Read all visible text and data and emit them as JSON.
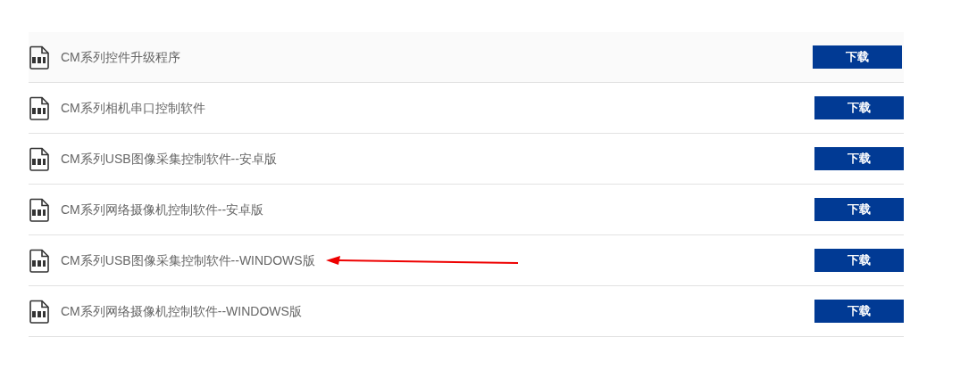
{
  "downloads": [
    {
      "title": "CM系列控件升级程序",
      "button": "下载",
      "highlighted": true,
      "arrow": false
    },
    {
      "title": "CM系列相机串口控制软件",
      "button": "下载",
      "highlighted": false,
      "arrow": false
    },
    {
      "title": "CM系列USB图像采集控制软件--安卓版",
      "button": "下载",
      "highlighted": false,
      "arrow": false
    },
    {
      "title": "CM系列网络摄像机控制软件--安卓版",
      "button": "下载",
      "highlighted": false,
      "arrow": false
    },
    {
      "title": "CM系列USB图像采集控制软件--WINDOWS版",
      "button": "下载",
      "highlighted": false,
      "arrow": true
    },
    {
      "title": "CM系列网络摄像机控制软件--WINDOWS版",
      "button": "下载",
      "highlighted": false,
      "arrow": false
    }
  ]
}
